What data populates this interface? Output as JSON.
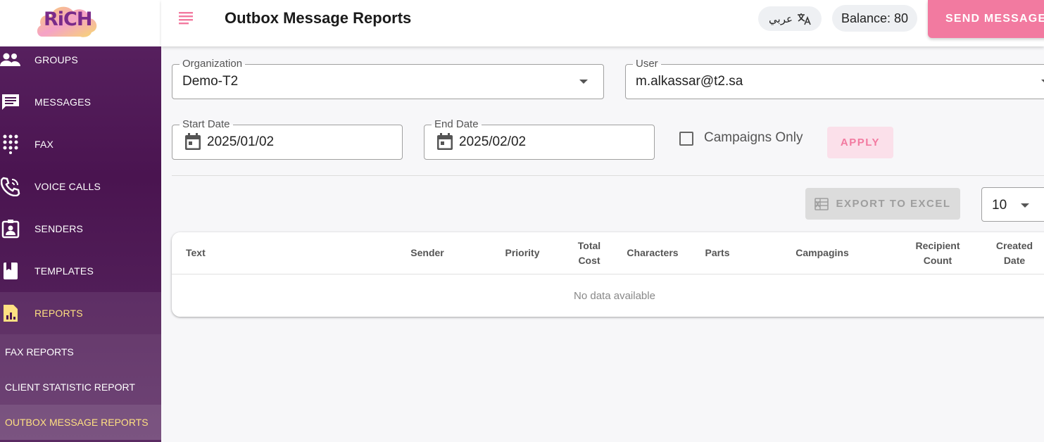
{
  "brand": {
    "logo_text": "RiCH"
  },
  "sidebar": {
    "items": [
      {
        "label": "GROUPS",
        "icon": "groups-icon"
      },
      {
        "label": "MESSAGES",
        "icon": "message-icon"
      },
      {
        "label": "FAX",
        "icon": "dialpad-icon"
      },
      {
        "label": "VOICE CALLS",
        "icon": "phone-icon"
      },
      {
        "label": "SENDERS",
        "icon": "badge-icon"
      },
      {
        "label": "TEMPLATES",
        "icon": "bookmark-book-icon"
      },
      {
        "label": "REPORTS",
        "icon": "report-chart-icon"
      }
    ],
    "sub_items": [
      {
        "label": "FAX REPORTS"
      },
      {
        "label": "CLIENT STATISTIC REPORT"
      },
      {
        "label": "OUTBOX MESSAGE REPORTS"
      }
    ]
  },
  "header": {
    "title": "Outbox Message Reports",
    "lang_label": "عربي",
    "balance_label": "Balance: 80",
    "send_label": "SEND MESSAGE"
  },
  "filters": {
    "organization": {
      "label": "Organization",
      "value": "Demo-T2"
    },
    "user": {
      "label": "User",
      "value": "m.alkassar@t2.sa"
    },
    "start_date": {
      "label": "Start Date",
      "value": "2025/01/02"
    },
    "end_date": {
      "label": "End Date",
      "value": "2025/02/02"
    },
    "campaigns_only_label": "Campaigns Only",
    "apply_label": "APPLY"
  },
  "toolbar": {
    "export_label": "EXPORT TO EXCEL",
    "per_page": "10"
  },
  "table": {
    "columns": [
      "Text",
      "Sender",
      "Priority",
      "Total Cost",
      "Characters",
      "Parts",
      "Campagins",
      "Recipient Count",
      "Created Date"
    ],
    "empty_text": "No data available"
  },
  "colors": {
    "accent": "#f27aa0",
    "sidebar": "#4a1450",
    "active_text": "#ffe082"
  }
}
